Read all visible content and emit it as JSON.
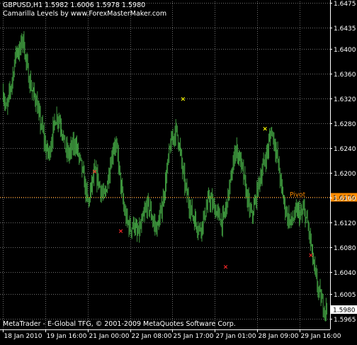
{
  "header": {
    "line1": "GBPUSD,H1  1.5982 1.6006 1.5978 1.5980",
    "line2": "Camarilla Levels by www.ForexMasterMaker.com"
  },
  "footer": {
    "copyright": "MetaTrader - E-Global TFG, © 2001-2009 MetaQuotes Software Corp."
  },
  "colors": {
    "background": "#000000",
    "candles": "#3f9a3f",
    "grid": "#6e6e6e",
    "axis_text": "#ffffff",
    "pivot": "#ff8c00",
    "marker_low": "#ff2a2a",
    "marker_high": "#ffff00",
    "current_price_box": "#ffffff"
  },
  "chart_data": {
    "type": "candlestick",
    "symbol": "GBPUSD",
    "timeframe": "H1",
    "ohlc_last": {
      "open": 1.5982,
      "high": 1.6006,
      "low": 1.5978,
      "close": 1.598
    },
    "ylim": [
      1.5948,
      1.6477
    ],
    "y_ticks": [
      "1.6475",
      "1.6435",
      "1.6400",
      "1.6360",
      "1.6320",
      "1.6280",
      "1.6240",
      "1.6200",
      "1.6160",
      "1.6120",
      "1.6080",
      "1.6040",
      "1.6005",
      "1.5965"
    ],
    "x_ticks": [
      "18 Jan 2010",
      "19 Jan 16:00",
      "21 Jan 00:00",
      "22 Jan 08:00",
      "25 Jan 17:00",
      "27 Jan 01:00",
      "28 Jan 09:00",
      "29 Jan 16:00"
    ],
    "price_path": [
      1.633,
      1.63,
      1.633,
      1.636,
      1.64,
      1.6395,
      1.642,
      1.638,
      1.635,
      1.633,
      1.632,
      1.629,
      1.627,
      1.624,
      1.623,
      1.626,
      1.629,
      1.629,
      1.627,
      1.624,
      1.623,
      1.624,
      1.625,
      1.623,
      1.621,
      1.618,
      1.615,
      1.618,
      1.62,
      1.619,
      1.617,
      1.616,
      1.619,
      1.622,
      1.625,
      1.623,
      1.618,
      1.614,
      1.612,
      1.611,
      1.612,
      1.61,
      1.611,
      1.613,
      1.615,
      1.614,
      1.612,
      1.611,
      1.613,
      1.616,
      1.62,
      1.624,
      1.626,
      1.627,
      1.624,
      1.62,
      1.617,
      1.615,
      1.613,
      1.612,
      1.611,
      1.612,
      1.614,
      1.616,
      1.615,
      1.614,
      1.613,
      1.612,
      1.614,
      1.617,
      1.62,
      1.624,
      1.623,
      1.621,
      1.618,
      1.615,
      1.613,
      1.615,
      1.618,
      1.62,
      1.622,
      1.624,
      1.627,
      1.625,
      1.622,
      1.618,
      1.615,
      1.613,
      1.612,
      1.613,
      1.614,
      1.613,
      1.614,
      1.612,
      1.609,
      1.605,
      1.602,
      1.6,
      1.5985,
      1.598
    ],
    "annotations": [
      {
        "label": "Pivot",
        "value": 1.6162,
        "price_label": "1.6170"
      },
      {
        "label": "Current price",
        "value": 1.598,
        "price_label": "1.5980"
      }
    ],
    "markers": [
      {
        "color": "yellow",
        "symbol": "×",
        "series_index": 55,
        "value": 1.632
      },
      {
        "color": "yellow",
        "symbol": "×",
        "series_index": 80,
        "value": 1.6272
      },
      {
        "color": "red",
        "symbol": "×",
        "series_index": 28,
        "value": 1.6203
      },
      {
        "color": "red",
        "symbol": "×",
        "series_index": 36,
        "value": 1.6107
      },
      {
        "color": "red",
        "symbol": "×",
        "series_index": 68,
        "value": 1.6049
      },
      {
        "color": "red",
        "symbol": "×",
        "series_index": 94,
        "value": 1.6068
      }
    ],
    "grid": true
  }
}
